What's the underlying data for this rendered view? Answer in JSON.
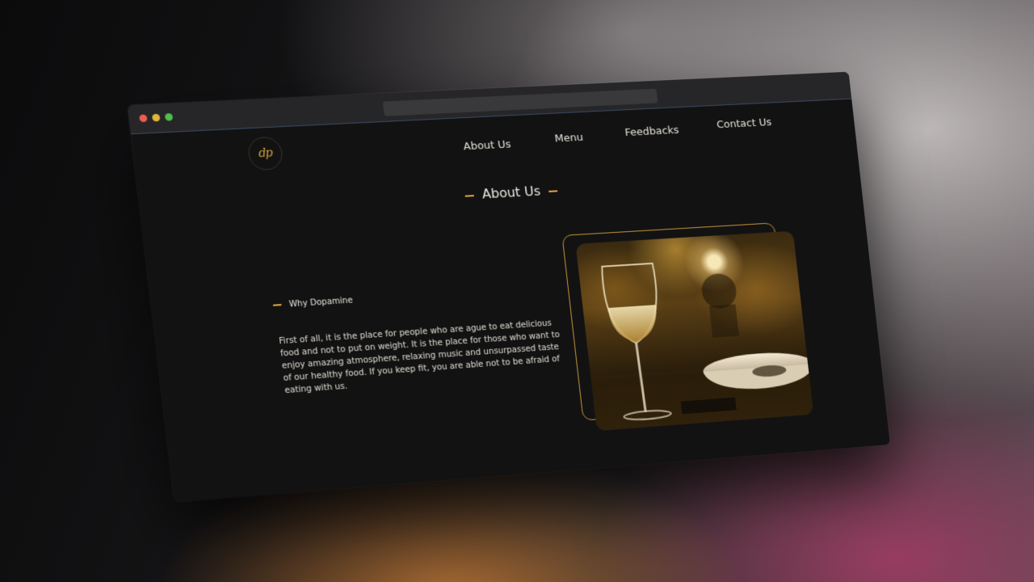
{
  "browser": {
    "controls": [
      "close",
      "minimize",
      "maximize"
    ],
    "address_bar_value": ""
  },
  "site": {
    "logo_text": "dp",
    "nav": [
      {
        "label": "About Us"
      },
      {
        "label": "Menu"
      },
      {
        "label": "Feedbacks"
      },
      {
        "label": "Contact Us"
      }
    ],
    "section_heading": "About Us",
    "subheading": "Why Dopamine",
    "paragraph": "First of all, it is the place for people who are ague to eat delicious food and not to put on weight. It is the place for those who want to enjoy amazing atmosphere, relaxing music and unsurpassed taste of our healthy food. If you keep fit, you are able not to be afraid of eating with us.",
    "image_subject": "wine-glass-and-bowl-restaurant-photo"
  },
  "colors": {
    "accent": "#e0a53c",
    "background": "#121212",
    "text": "#e9e6df"
  }
}
